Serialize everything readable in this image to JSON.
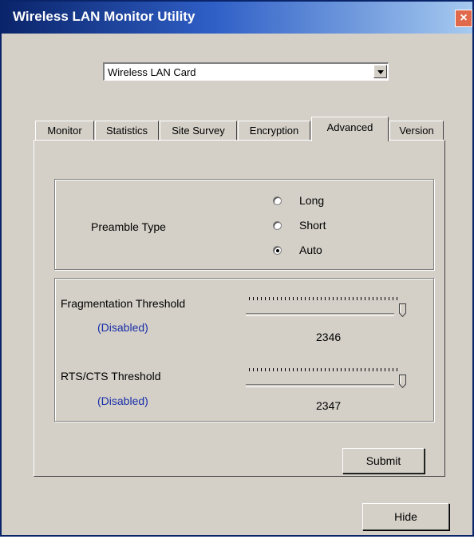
{
  "window": {
    "title": "Wireless LAN Monitor Utility",
    "close_label": "×"
  },
  "device_select": {
    "selected": "Wireless LAN Card"
  },
  "tabs": [
    {
      "label": "Monitor"
    },
    {
      "label": "Statistics"
    },
    {
      "label": "Site Survey"
    },
    {
      "label": "Encryption"
    },
    {
      "label": "Advanced",
      "active": true
    },
    {
      "label": "Version"
    }
  ],
  "preamble": {
    "label": "Preamble Type",
    "options": [
      {
        "label": "Long",
        "checked": false
      },
      {
        "label": "Short",
        "checked": false
      },
      {
        "label": "Auto",
        "checked": true
      }
    ]
  },
  "fragmentation": {
    "label": "Fragmentation Threshold",
    "status": "(Disabled)",
    "value": "2346"
  },
  "rts_cts": {
    "label": "RTS/CTS Threshold",
    "status": "(Disabled)",
    "value": "2347"
  },
  "buttons": {
    "submit": "Submit",
    "hide": "Hide"
  }
}
